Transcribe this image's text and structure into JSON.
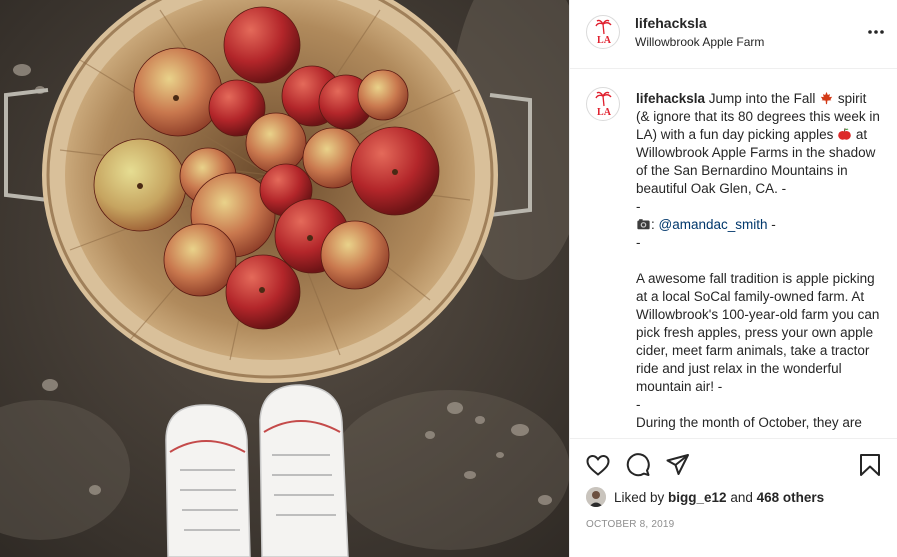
{
  "post": {
    "username": "lifehacksla",
    "location": "Willowbrook Apple Farm",
    "avatar_logo_text": "LA",
    "colors": {
      "brand_red": "#e0202e",
      "link": "#00376b",
      "text": "#262626",
      "muted": "#8e8e8e"
    }
  },
  "caption": {
    "username": "lifehacksla",
    "p1": " Jump into the Fall ",
    "p2": " spirit (& ignore that its 80 degrees this week in LA) with a fun day picking apples ",
    "p3": " at Willowbrook Apple Farms in the shadow of the San Bernardino Mountains in beautiful Oak Glen, CA. -\n-\n",
    "p4": ": ",
    "mention": "@amandac_smith",
    "p5": " -\n-\n\nA awesome fall tradition is apple picking at a local SoCal family-owned farm. At Willowbrook's 100-year-old farm you can pick fresh apples, press your own apple cider, meet farm animals, take a tractor ride and just relax in the wonderful mountain air! -\n-\nDuring the month of October, they are",
    "emojis": [
      "maple-leaf",
      "red-apple",
      "camera"
    ]
  },
  "actions": {
    "icons": [
      "heart-icon",
      "comment-icon",
      "share-icon",
      "save-icon"
    ]
  },
  "likes": {
    "prefix": "Liked by ",
    "user": "bigg_e12",
    "middle": " and ",
    "count": "468 others"
  },
  "date": "OCTOBER 8, 2019"
}
